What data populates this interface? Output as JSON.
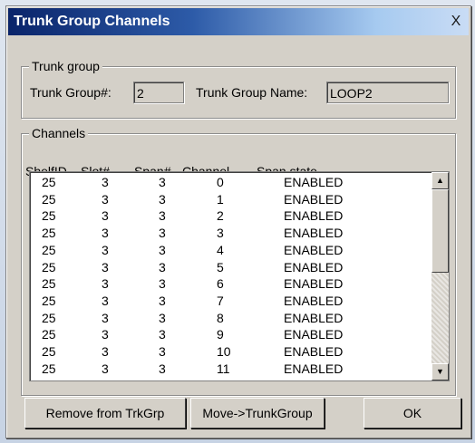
{
  "dialog": {
    "title": "Trunk Group Channels",
    "close_glyph": "X"
  },
  "trunk_group": {
    "legend": "Trunk group",
    "number_label": "Trunk Group#:",
    "number_value": "2",
    "name_label": "Trunk Group Name:",
    "name_value": "LOOP2"
  },
  "channels": {
    "legend": "Channels",
    "columns": [
      "ShelfID",
      "Slot#",
      "Span#",
      "Channel",
      "Span state"
    ],
    "rows": [
      [
        "25",
        "3",
        "3",
        "0",
        "ENABLED"
      ],
      [
        "25",
        "3",
        "3",
        "1",
        "ENABLED"
      ],
      [
        "25",
        "3",
        "3",
        "2",
        "ENABLED"
      ],
      [
        "25",
        "3",
        "3",
        "3",
        "ENABLED"
      ],
      [
        "25",
        "3",
        "3",
        "4",
        "ENABLED"
      ],
      [
        "25",
        "3",
        "3",
        "5",
        "ENABLED"
      ],
      [
        "25",
        "3",
        "3",
        "6",
        "ENABLED"
      ],
      [
        "25",
        "3",
        "3",
        "7",
        "ENABLED"
      ],
      [
        "25",
        "3",
        "3",
        "8",
        "ENABLED"
      ],
      [
        "25",
        "3",
        "3",
        "9",
        "ENABLED"
      ],
      [
        "25",
        "3",
        "3",
        "10",
        "ENABLED"
      ],
      [
        "25",
        "3",
        "3",
        "11",
        "ENABLED"
      ]
    ]
  },
  "buttons": {
    "remove": "Remove from TrkGrp",
    "move": "Move->TrunkGroup",
    "ok": "OK"
  },
  "scrollbar": {
    "up_icon": "arrow-up-icon",
    "down_icon": "arrow-down-icon"
  }
}
